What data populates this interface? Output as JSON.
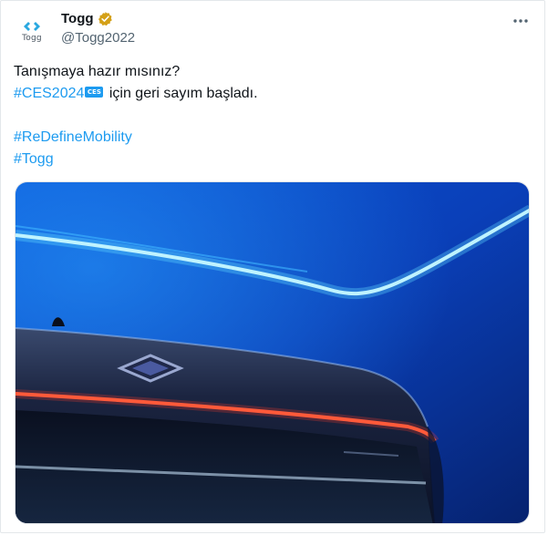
{
  "tweet": {
    "account": {
      "avatar_text": "Togg",
      "display_name": "Togg",
      "handle": "@Togg2022",
      "avatar_icon": "togg-logo-icon",
      "verified_icon": "verified-badge-icon",
      "verified_color": "#d4a017"
    },
    "more_icon": "more-horizontal-icon",
    "text": {
      "line1": "Tanışmaya hazır mısınız?",
      "hashtag_ces": "#CES2024",
      "ces_emoji_text": "CES",
      "line2_rest": " için geri sayım başladı.",
      "hashtag_redefine": "#ReDefineMobility",
      "hashtag_togg": "#Togg"
    },
    "media": {
      "type": "image",
      "subject": "car-rear-photo"
    },
    "colors": {
      "link": "#1d9bf0",
      "text": "#0f1419",
      "secondary": "#536471"
    }
  }
}
